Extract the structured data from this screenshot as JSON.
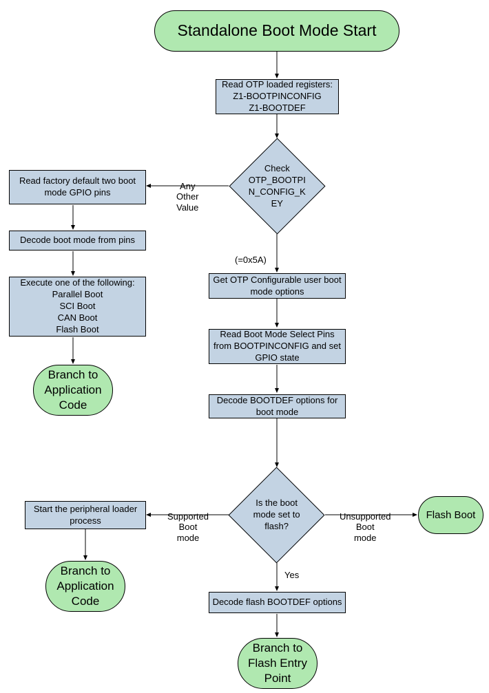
{
  "nodes": {
    "start": "Standalone Boot Mode Start",
    "readOtp": "Read OTP loaded registers:\nZ1-BOOTPINCONFIG\nZ1-BOOTDEF",
    "checkKey": "Check OTP_BOOTPIN_CONFIG_KEY",
    "readFactory": "Read factory default two boot mode GPIO pins",
    "decodePins": "Decode boot mode from pins",
    "executeBoot": "Execute one of the following:\nParallel Boot\nSCI Boot\nCAN Boot\nFlash Boot",
    "branchApp1": "Branch to Application Code",
    "getOtpConfig": "Get OTP Configurable user boot mode options",
    "readBootSelect": "Read Boot Mode Select Pins from BOOTPINCONFIG and set GPIO state",
    "decodeBootdef": "Decode BOOTDEF options for boot mode",
    "isFlash": "Is the boot mode set to flash?",
    "startLoader": "Start the peripheral loader process",
    "branchApp2": "Branch to Application Code",
    "flashBoot": "Flash Boot",
    "decodeFlash": "Decode flash BOOTDEF options",
    "branchFlash": "Branch to Flash Entry Point"
  },
  "labels": {
    "anyOther": "Any\nOther\nValue",
    "eq5A": "(=0x5A)",
    "supported": "Supported\nBoot\nmode",
    "unsupported": "Unsupported\nBoot\nmode",
    "yes": "Yes"
  }
}
